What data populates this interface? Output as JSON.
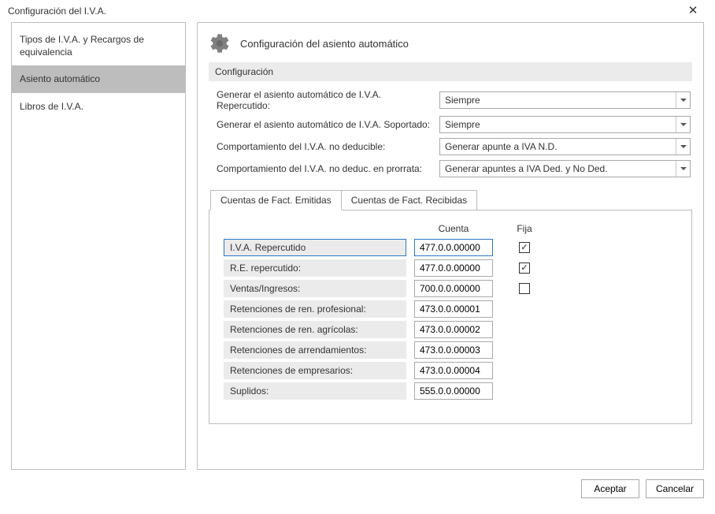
{
  "window": {
    "title": "Configuración del I.V.A."
  },
  "sidebar": {
    "items": [
      {
        "label": "Tipos de I.V.A. y Recargos de equivalencia",
        "selected": false
      },
      {
        "label": "Asiento automático",
        "selected": true
      },
      {
        "label": "Libros de I.V.A.",
        "selected": false
      }
    ]
  },
  "page": {
    "heading": "Configuración del asiento automático",
    "section_title": "Configuración"
  },
  "form": {
    "rows": [
      {
        "label": "Generar el asiento automático de I.V.A. Repercutido:",
        "value": "Siempre"
      },
      {
        "label": "Generar el asiento automático de I.V.A. Soportado:",
        "value": "Siempre"
      },
      {
        "label": "Comportamiento del I.V.A. no deducible:",
        "value": "Generar apunte a IVA N.D."
      },
      {
        "label": "Comportamiento del I.V.A. no deduc. en prorrata:",
        "value": "Generar apuntes a IVA Ded. y No Ded."
      }
    ]
  },
  "tabs": {
    "items": [
      {
        "label": "Cuentas de Fact. Emitidas",
        "active": true
      },
      {
        "label": "Cuentas de Fact. Recibidas",
        "active": false
      }
    ]
  },
  "table": {
    "columns": {
      "cuenta": "Cuenta",
      "fija": "Fija"
    },
    "rows": [
      {
        "label": "I.V.A. Repercutido",
        "cuenta": "477.0.0.00000",
        "fija": true,
        "show_fija": true,
        "highlight": true
      },
      {
        "label": "R.E. repercutido:",
        "cuenta": "477.0.0.00000",
        "fija": true,
        "show_fija": true,
        "highlight": false
      },
      {
        "label": "Ventas/Ingresos:",
        "cuenta": "700.0.0.00000",
        "fija": false,
        "show_fija": true,
        "highlight": false
      },
      {
        "label": "Retenciones de ren. profesional:",
        "cuenta": "473.0.0.00001",
        "fija": false,
        "show_fija": false,
        "highlight": false
      },
      {
        "label": "Retenciones de ren. agrícolas:",
        "cuenta": "473.0.0.00002",
        "fija": false,
        "show_fija": false,
        "highlight": false
      },
      {
        "label": "Retenciones de arrendamientos:",
        "cuenta": "473.0.0.00003",
        "fija": false,
        "show_fija": false,
        "highlight": false
      },
      {
        "label": "Retenciones de empresarios:",
        "cuenta": "473.0.0.00004",
        "fija": false,
        "show_fija": false,
        "highlight": false
      },
      {
        "label": "Suplidos:",
        "cuenta": "555.0.0.00000",
        "fija": false,
        "show_fija": false,
        "highlight": false
      }
    ]
  },
  "footer": {
    "accept": "Aceptar",
    "cancel": "Cancelar"
  }
}
